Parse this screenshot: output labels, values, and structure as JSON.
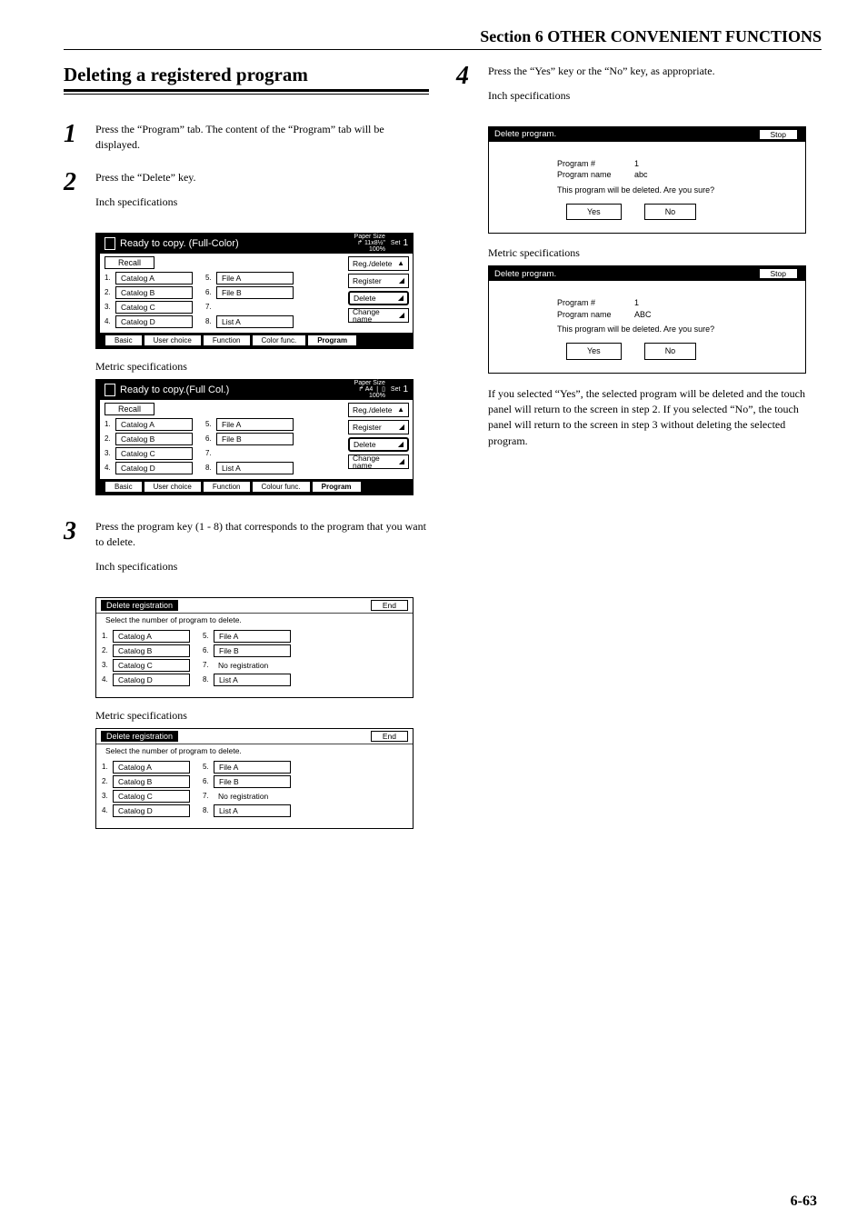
{
  "section_title": "Section 6  OTHER CONVENIENT FUNCTIONS",
  "heading": "Deleting a registered program",
  "page_number": "6-63",
  "labels": {
    "inch": "Inch specifications",
    "metric": "Metric specifications"
  },
  "steps": {
    "s1": {
      "num": "1",
      "text": "Press the “Program” tab.\nThe content of the “Program” tab will be displayed."
    },
    "s2": {
      "num": "2",
      "text": "Press the “Delete” key."
    },
    "s3": {
      "num": "3",
      "text": "Press the program key (1 - 8) that corresponds to the program that you want to delete."
    },
    "s4": {
      "num": "4",
      "text": "Press the “Yes” key or the “No” key, as appropriate."
    }
  },
  "ready_panel": {
    "title_inch": "Ready to copy.  (Full-Color)",
    "title_metric": "Ready to copy.(Full Col.)",
    "paper_label": "Paper Size",
    "paper_size_inch": "11x8½\"",
    "paper_size_metric": "A4",
    "set_label": "Set",
    "set_val": "1",
    "percent": "100%",
    "recall": "Recall",
    "slots_left": [
      {
        "idx": "1.",
        "name": "Catalog A"
      },
      {
        "idx": "2.",
        "name": "Catalog B"
      },
      {
        "idx": "3.",
        "name": "Catalog C"
      },
      {
        "idx": "4.",
        "name": "Catalog D"
      }
    ],
    "slots_right": [
      {
        "idx": "5.",
        "name": "File A"
      },
      {
        "idx": "6.",
        "name": "File B"
      },
      {
        "idx": "7.",
        "name": ""
      },
      {
        "idx": "8.",
        "name": "List A"
      }
    ],
    "rbuttons": {
      "reg_delete": "Reg./delete",
      "register": "Register",
      "delete": "Delete",
      "change_name": "Change name"
    },
    "tabs_inch": [
      "Basic",
      "User choice",
      "Function",
      "Color func.",
      "Program"
    ],
    "tabs_metric": [
      "Basic",
      "User choice",
      "Function",
      "Colour func.",
      "Program"
    ]
  },
  "delreg_panel": {
    "title": "Delete registration",
    "end": "End",
    "subtitle": "Select the number of program to delete.",
    "slots_left": [
      {
        "idx": "1.",
        "name": "Catalog A"
      },
      {
        "idx": "2.",
        "name": "Catalog B"
      },
      {
        "idx": "3.",
        "name": "Catalog C"
      },
      {
        "idx": "4.",
        "name": "Catalog D"
      }
    ],
    "slots_right": [
      {
        "idx": "5.",
        "name": "File A"
      },
      {
        "idx": "6.",
        "name": "File B"
      },
      {
        "idx": "7.",
        "name": "No registration",
        "noborder": true
      },
      {
        "idx": "8.",
        "name": "List A"
      }
    ]
  },
  "confirm_panel": {
    "title": "Delete program.",
    "stop": "Stop",
    "prognum_k": "Program #",
    "prognum_v": "1",
    "progname_k_inch": "Program name",
    "progname_v_inch": "abc",
    "progname_k_metric": "Program name",
    "progname_v_metric": "ABC",
    "msg": "This program will be deleted. Are you sure?",
    "yes": "Yes",
    "no": "No"
  },
  "result_text": "If you selected “Yes”, the selected program will be deleted and the touch panel will return to the screen in step 2. If you selected “No”, the touch panel will return to the screen in step 3 without deleting the selected program."
}
